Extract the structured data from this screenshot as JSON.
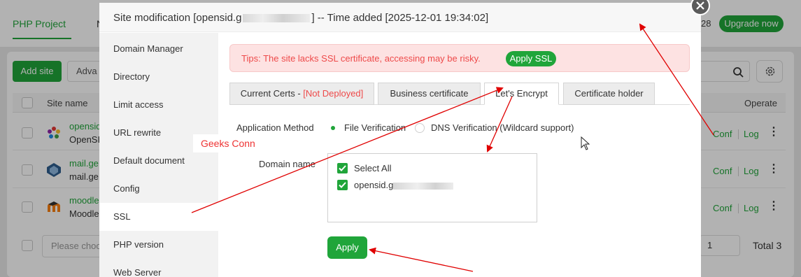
{
  "background": {
    "tabs": [
      "PHP Project",
      "N"
    ],
    "count_28": "28",
    "upgrade_label": "Upgrade now",
    "add_site_label": "Add site",
    "advanced_label": "Adva",
    "table": {
      "header_site": "Site name",
      "header_operate": "Operate",
      "rows": [
        {
          "name": "opensid",
          "sub": "OpenSI",
          "conf": "Conf",
          "log": "Log"
        },
        {
          "name": "mail.ge",
          "sub": "mail.ge",
          "conf": "Conf",
          "log": "Log"
        },
        {
          "name": "moodle",
          "sub": "Moodle",
          "conf": "Conf",
          "log": "Log"
        }
      ]
    },
    "choose_placeholder": "Please choo",
    "page_value": "1",
    "total_label": "Total 3"
  },
  "modal": {
    "title_prefix": "Site modification [opensid.g",
    "title_suffix": "] -- Time added [2025-12-01 19:34:02]",
    "nav": [
      "Domain Manager",
      "Directory",
      "Limit access",
      "URL rewrite",
      "Default document",
      "Config",
      "SSL",
      "PHP version",
      "Web Server"
    ],
    "nav_active": "SSL",
    "tips_text": "Tips: The site lacks SSL certificate, accessing may be risky.",
    "apply_ssl_label": "Apply SSL",
    "tabs": {
      "current_certs": "Current Certs - ",
      "not_deployed": "[Not Deployed]",
      "business": "Business certificate",
      "lets_encrypt": "Let's Encrypt",
      "holder": "Certificate holder"
    },
    "application_method_label": "Application Method",
    "method_file": "File Verification",
    "method_dns": "DNS Verification (Wildcard support)",
    "selected_method": "File Verification",
    "domain_name_label": "Domain name",
    "select_all_label": "Select All",
    "domain_entry": "opensid.g",
    "apply_label": "Apply"
  },
  "annotation_text": "Geeks Conn",
  "colors": {
    "accent": "#20a53a",
    "danger": "#ee4a4a",
    "annotation": "#e00000"
  }
}
